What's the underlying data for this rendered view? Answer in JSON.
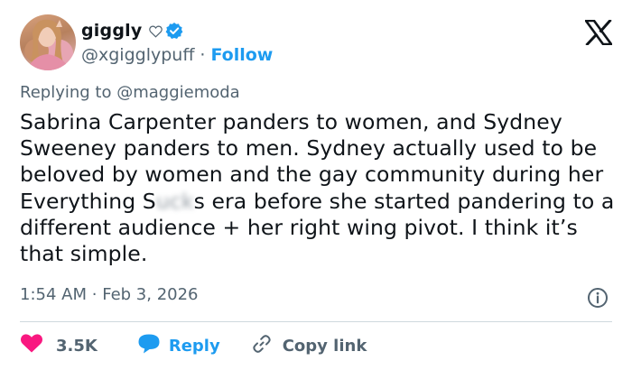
{
  "author": {
    "display_name": "giggly",
    "handle": "@xgigglypuff",
    "separator": "·",
    "follow_label": "Follow"
  },
  "reply": {
    "prefix": "Replying to",
    "mention": "@maggiemoda"
  },
  "tweet": {
    "text_before_redaction": "Sabrina Carpenter panders to women, and Sydney Sweeney panders to men. Sydney actually used to be beloved by women and the gay community during her Everything S",
    "redacted": "uck",
    "text_after_redaction": "s era before she started pandering to a different audience + her right wing pivot. I think it’s that simple."
  },
  "meta": {
    "time": "1:54 AM",
    "separator": "·",
    "date": "Feb 3, 2026"
  },
  "actions": {
    "like_count": "3.5K",
    "reply_label": "Reply",
    "copy_label": "Copy link"
  },
  "colors": {
    "accent": "#1d9bf0",
    "like": "#f91880",
    "secondary_text": "#536471",
    "primary_text": "#0f1419",
    "divider": "#cfd9de"
  },
  "icons": [
    "heart-outline-icon",
    "verified-badge-icon",
    "x-logo-icon",
    "info-icon",
    "heart-filled-icon",
    "speech-bubble-icon",
    "link-icon"
  ]
}
